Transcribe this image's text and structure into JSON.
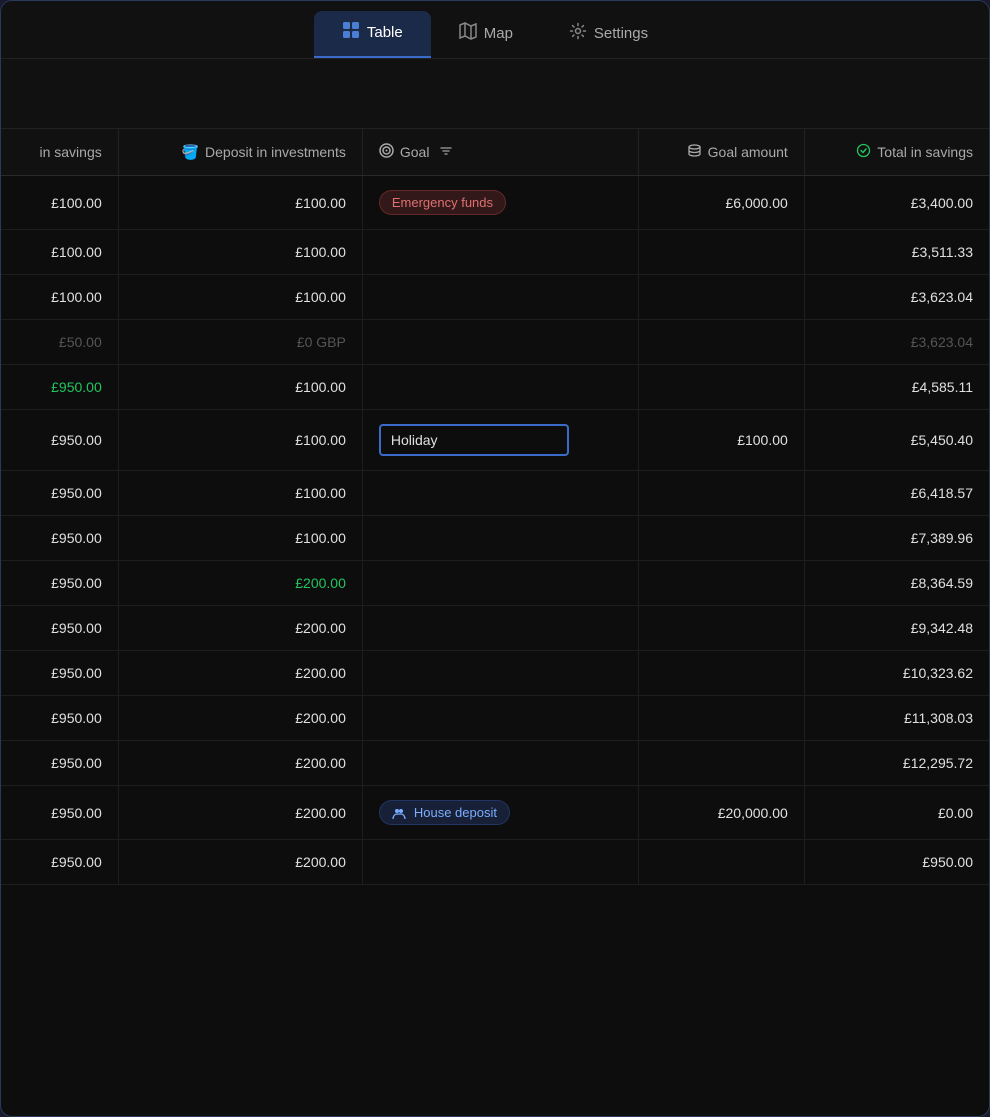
{
  "nav": {
    "tabs": [
      {
        "id": "table",
        "label": "Table",
        "icon": "⊞",
        "active": true
      },
      {
        "id": "map",
        "label": "Map",
        "icon": "🗺",
        "active": false
      },
      {
        "id": "settings",
        "label": "Settings",
        "icon": "⚙",
        "active": false
      }
    ]
  },
  "table": {
    "columns": [
      {
        "id": "deposit_savings",
        "label": "in savings",
        "icon": ""
      },
      {
        "id": "deposit_investments",
        "label": "Deposit in investments",
        "icon": "🪣"
      },
      {
        "id": "goal",
        "label": "Goal",
        "icon": "◎",
        "hasFilter": true
      },
      {
        "id": "goal_amount",
        "label": "Goal amount",
        "icon": "🗄"
      },
      {
        "id": "total_savings",
        "label": "Total in savings",
        "icon": "↻"
      }
    ],
    "rows": [
      {
        "deposit_savings": "£100.00",
        "deposit_investments": "£100.00",
        "goal": "Emergency funds",
        "goal_type": "emergency",
        "goal_amount": "£6,000.00",
        "total_savings": "£3,400.00"
      },
      {
        "deposit_savings": "£100.00",
        "deposit_investments": "£100.00",
        "goal": "",
        "goal_type": "",
        "goal_amount": "",
        "total_savings": "£3,511.33"
      },
      {
        "deposit_savings": "£100.00",
        "deposit_investments": "£100.00",
        "goal": "",
        "goal_type": "",
        "goal_amount": "",
        "total_savings": "£3,623.04"
      },
      {
        "deposit_savings": "£50.00",
        "deposit_investments": "£0 GBP",
        "goal": "",
        "goal_type": "",
        "goal_amount": "",
        "total_savings": "£3,623.04",
        "muted": true
      },
      {
        "deposit_savings": "£950.00",
        "deposit_investments": "£100.00",
        "goal": "",
        "goal_type": "",
        "goal_amount": "",
        "total_savings": "£4,585.11",
        "savings_green": true
      },
      {
        "deposit_savings": "£950.00",
        "deposit_investments": "£100.00",
        "goal": "Holiday",
        "goal_type": "editing",
        "goal_amount": "£100.00",
        "total_savings": "£5,450.40"
      },
      {
        "deposit_savings": "£950.00",
        "deposit_investments": "£100.00",
        "goal": "",
        "goal_type": "",
        "goal_amount": "",
        "total_savings": "£6,418.57"
      },
      {
        "deposit_savings": "£950.00",
        "deposit_investments": "£100.00",
        "goal": "",
        "goal_type": "",
        "goal_amount": "",
        "total_savings": "£7,389.96"
      },
      {
        "deposit_savings": "£950.00",
        "deposit_investments": "£200.00",
        "goal": "",
        "goal_type": "",
        "goal_amount": "",
        "total_savings": "£8,364.59",
        "investments_green": true
      },
      {
        "deposit_savings": "£950.00",
        "deposit_investments": "£200.00",
        "goal": "",
        "goal_type": "",
        "goal_amount": "",
        "total_savings": "£9,342.48"
      },
      {
        "deposit_savings": "£950.00",
        "deposit_investments": "£200.00",
        "goal": "",
        "goal_type": "",
        "goal_amount": "",
        "total_savings": "£10,323.62"
      },
      {
        "deposit_savings": "£950.00",
        "deposit_investments": "£200.00",
        "goal": "",
        "goal_type": "",
        "goal_amount": "",
        "total_savings": "£11,308.03"
      },
      {
        "deposit_savings": "£950.00",
        "deposit_investments": "£200.00",
        "goal": "",
        "goal_type": "",
        "goal_amount": "",
        "total_savings": "£12,295.72"
      },
      {
        "deposit_savings": "£950.00",
        "deposit_investments": "£200.00",
        "goal": "House deposit",
        "goal_type": "house",
        "goal_amount": "£20,000.00",
        "total_savings": "£0.00"
      },
      {
        "deposit_savings": "£950.00",
        "deposit_investments": "£200.00",
        "goal": "",
        "goal_type": "",
        "goal_amount": "",
        "total_savings": "£950.00"
      }
    ]
  }
}
